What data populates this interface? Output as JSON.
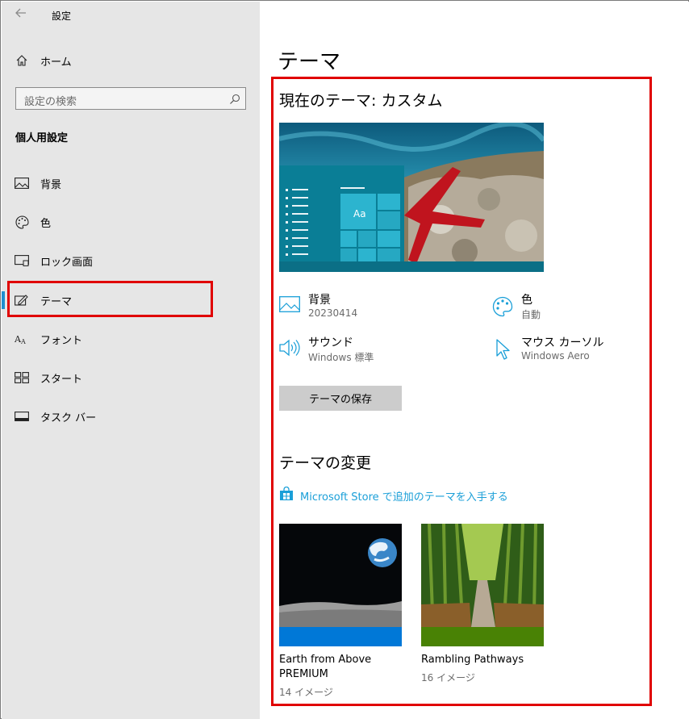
{
  "window": {
    "title": "設定"
  },
  "sidebar": {
    "home_label": "ホーム",
    "search_placeholder": "設定の検索",
    "section_title": "個人用設定",
    "items": [
      {
        "label": "背景",
        "icon": "picture-icon"
      },
      {
        "label": "色",
        "icon": "palette-icon"
      },
      {
        "label": "ロック画面",
        "icon": "lockscreen-icon"
      },
      {
        "label": "テーマ",
        "icon": "theme-brush-icon",
        "active": true
      },
      {
        "label": "フォント",
        "icon": "font-icon"
      },
      {
        "label": "スタート",
        "icon": "start-icon"
      },
      {
        "label": "タスク バー",
        "icon": "taskbar-icon"
      }
    ]
  },
  "main": {
    "page_title": "テーマ",
    "current_theme_title": "現在のテーマ: カスタム",
    "preview_tile_text": "Aa",
    "properties": {
      "background": {
        "name": "背景",
        "value": "20230414"
      },
      "color": {
        "name": "色",
        "value": "自動"
      },
      "sound": {
        "name": "サウンド",
        "value": "Windows 標準"
      },
      "cursor": {
        "name": "マウス カーソル",
        "value": "Windows Aero"
      }
    },
    "save_button": "テーマの保存",
    "change_title": "テーマの変更",
    "store_link": "Microsoft Store で追加のテーマを入手する",
    "themes": [
      {
        "name": "Earth from Above PREMIUM",
        "count": "14 イメージ",
        "accent": "#0078d7"
      },
      {
        "name": "Rambling Pathways",
        "count": "16 イメージ",
        "accent": "#498205"
      }
    ]
  },
  "colors": {
    "accent": "#1f8fcf",
    "highlight_box": "#e00000",
    "link": "#1a9fd8"
  }
}
